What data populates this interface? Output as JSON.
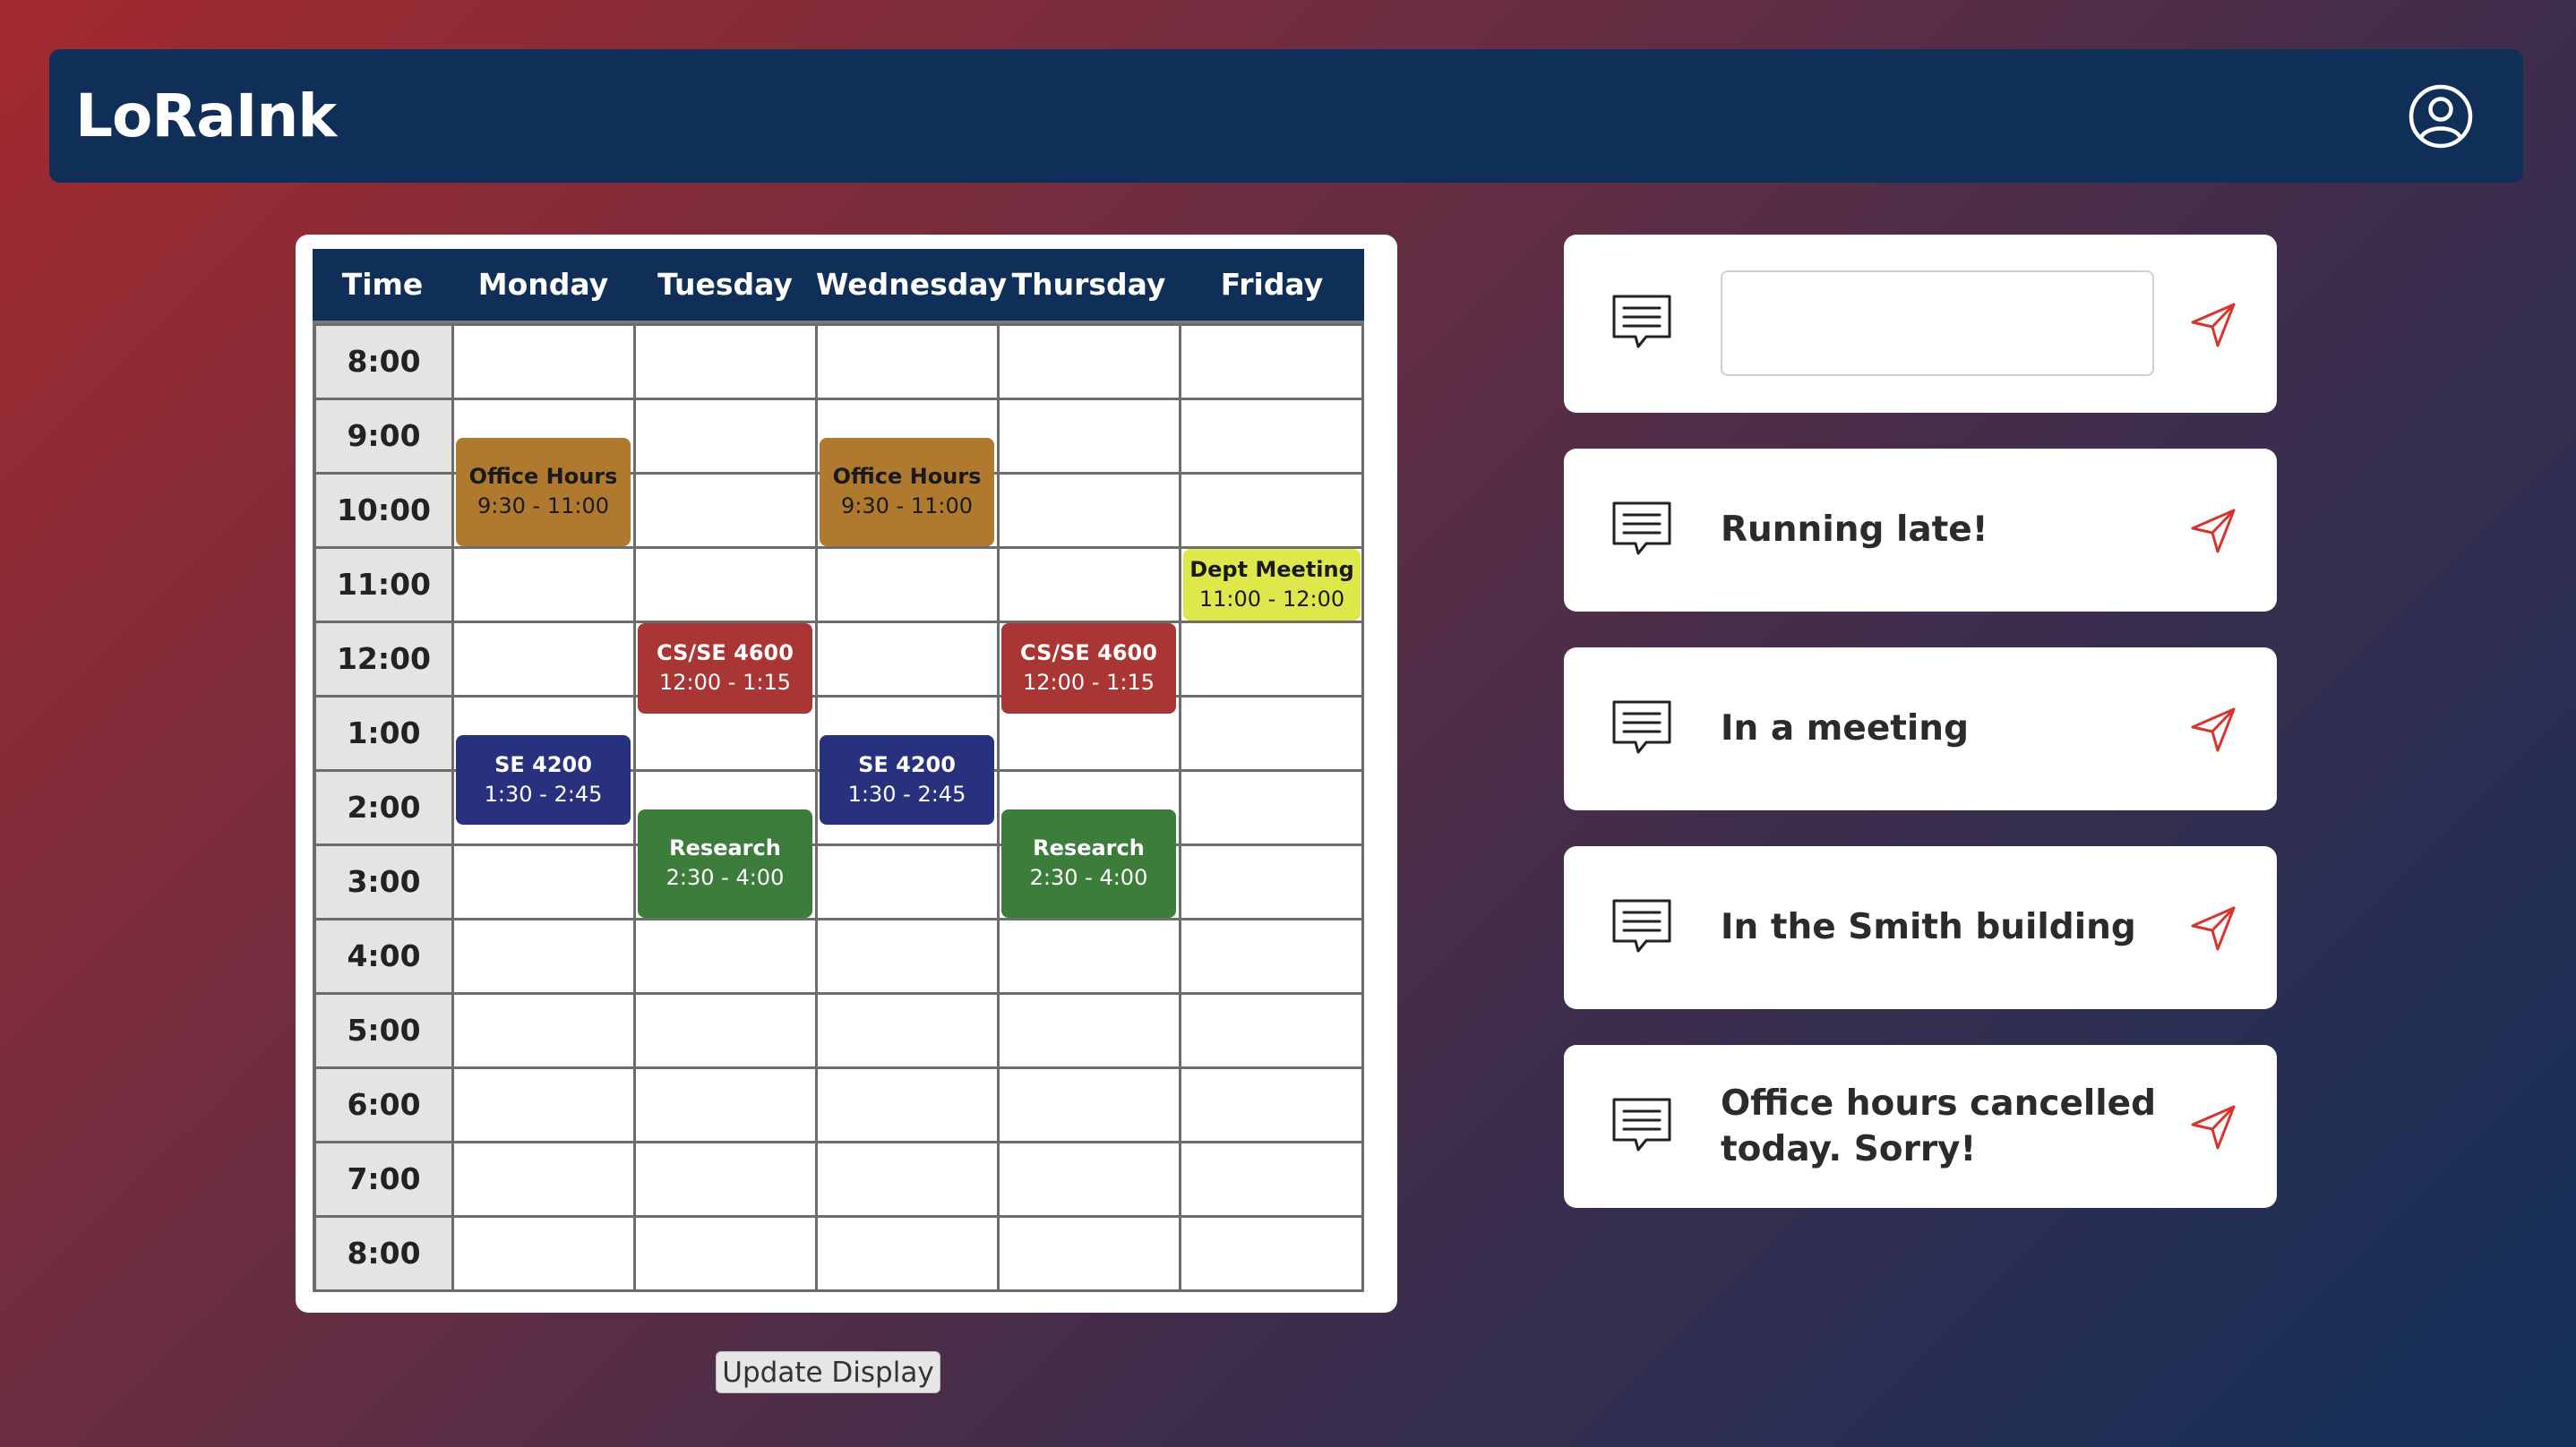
{
  "app": {
    "title": "LoRaInk"
  },
  "header": {
    "profile_icon": "user-circle-icon"
  },
  "schedule": {
    "columns": [
      "Time",
      "Monday",
      "Tuesday",
      "Wednesday",
      "Thursday",
      "Friday"
    ],
    "times": [
      "8:00",
      "9:00",
      "10:00",
      "11:00",
      "12:00",
      "1:00",
      "2:00",
      "3:00",
      "4:00",
      "5:00",
      "6:00",
      "7:00",
      "8:00"
    ],
    "events": [
      {
        "title": "Office Hours",
        "time": "9:30 - 11:00",
        "day": "Monday",
        "color": "#b07a2e",
        "text_color": "#1a1a1a"
      },
      {
        "title": "Office Hours",
        "time": "9:30 - 11:00",
        "day": "Wednesday",
        "color": "#b07a2e",
        "text_color": "#1a1a1a"
      },
      {
        "title": "Dept Meeting",
        "time": "11:00 - 12:00",
        "day": "Friday",
        "color": "#dfe84a",
        "text_color": "#1a1a1a"
      },
      {
        "title": "CS/SE 4600",
        "time": "12:00 - 1:15",
        "day": "Tuesday",
        "color": "#a93534",
        "text_color": "#ffffff"
      },
      {
        "title": "CS/SE 4600",
        "time": "12:00 - 1:15",
        "day": "Thursday",
        "color": "#a93534",
        "text_color": "#ffffff"
      },
      {
        "title": "SE 4200",
        "time": "1:30 - 2:45",
        "day": "Monday",
        "color": "#27317e",
        "text_color": "#ffffff"
      },
      {
        "title": "SE 4200",
        "time": "1:30 - 2:45",
        "day": "Wednesday",
        "color": "#27317e",
        "text_color": "#ffffff"
      },
      {
        "title": "Research",
        "time": "2:30 - 4:00",
        "day": "Tuesday",
        "color": "#3d7d3b",
        "text_color": "#ffffff"
      },
      {
        "title": "Research",
        "time": "2:30 - 4:00",
        "day": "Thursday",
        "color": "#3d7d3b",
        "text_color": "#ffffff"
      }
    ]
  },
  "update_button": {
    "label": "Update Display"
  },
  "messages": {
    "custom_input": {
      "value": "",
      "placeholder": ""
    },
    "presets": [
      {
        "text": "Running late!"
      },
      {
        "text": "In a meeting"
      },
      {
        "text": "In the Smith building"
      },
      {
        "text": "Office hours cancelled today. Sorry!"
      }
    ],
    "message_icon": "message-lines-icon",
    "send_icon": "paper-plane-icon"
  },
  "colors": {
    "header_bg": "#0f2f58",
    "accent_red": "#d8342e",
    "background_gradient": [
      "#a32a2e",
      "#12305a"
    ]
  }
}
